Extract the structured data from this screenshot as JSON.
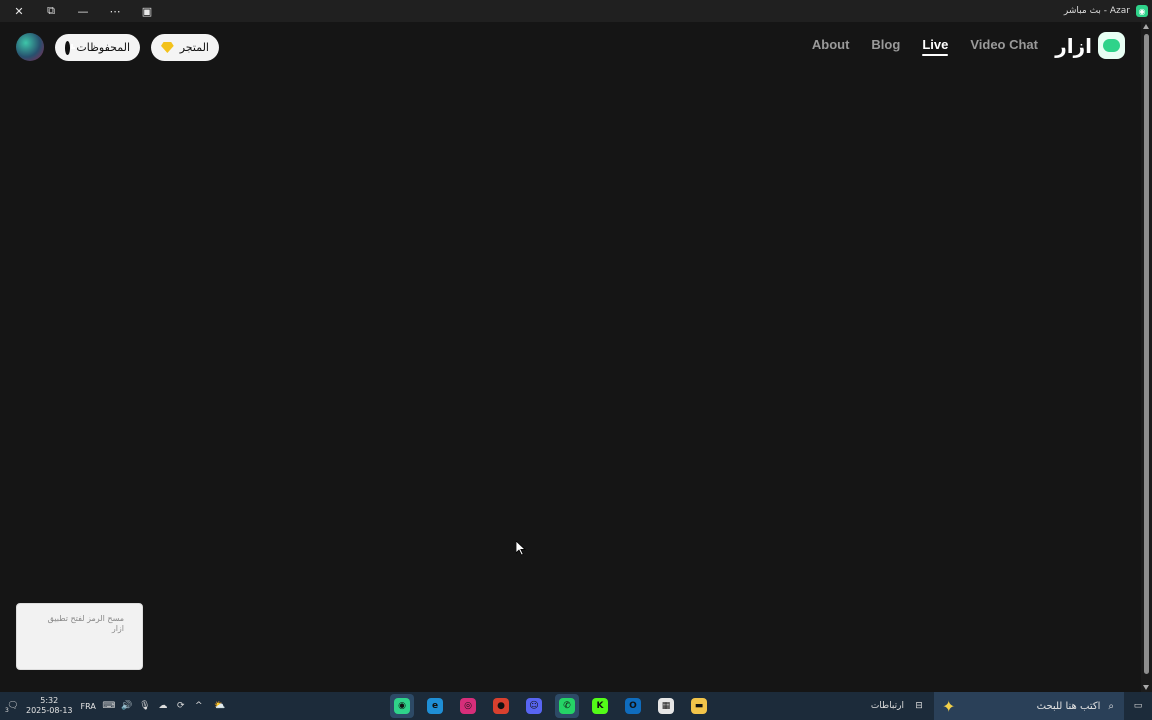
{
  "window": {
    "title": "بث مباشر - Azar",
    "controls": [
      "close",
      "restore",
      "minimize",
      "more",
      "split"
    ]
  },
  "header": {
    "logo_text": "ازار",
    "nav": [
      {
        "label": "About",
        "active": false
      },
      {
        "label": "Blog",
        "active": false
      },
      {
        "label": "Live",
        "active": true
      },
      {
        "label": "Video Chat",
        "active": false
      }
    ],
    "saved_label": "المحفوظات",
    "store_label": "المتجر"
  },
  "qr_card": {
    "text": "مسح الرمز لفتح تطبيق ازار"
  },
  "taskbar": {
    "time": "5:32",
    "date": "2025-08-13",
    "language": "FRA",
    "notification_count": "3",
    "widgets_label": "ارتباطات",
    "search_placeholder": "اكتب هنا للبحث",
    "apps": [
      {
        "name": "azar-app-icon",
        "color": "#2fd38a",
        "glyph": "◉",
        "active": true
      },
      {
        "name": "edge-icon",
        "color": "#1f8fd6",
        "glyph": "e",
        "active": false
      },
      {
        "name": "instagram-icon",
        "color": "#d62e7a",
        "glyph": "◎",
        "active": false
      },
      {
        "name": "chrome-icon",
        "color": "#d8402e",
        "glyph": "●",
        "active": false
      },
      {
        "name": "discord-icon",
        "color": "#5865f2",
        "glyph": "☺",
        "active": false
      },
      {
        "name": "whatsapp-icon",
        "color": "#25d366",
        "glyph": "✆",
        "active": true
      },
      {
        "name": "kick-icon",
        "color": "#53fc18",
        "glyph": "K",
        "active": false
      },
      {
        "name": "outlook-icon",
        "color": "#0f6cbd",
        "glyph": "O",
        "active": false
      },
      {
        "name": "store-icon",
        "color": "#e6e6e6",
        "glyph": "▦",
        "active": false
      },
      {
        "name": "file-explorer-icon",
        "color": "#f2c44a",
        "glyph": "▬",
        "active": false
      }
    ]
  }
}
